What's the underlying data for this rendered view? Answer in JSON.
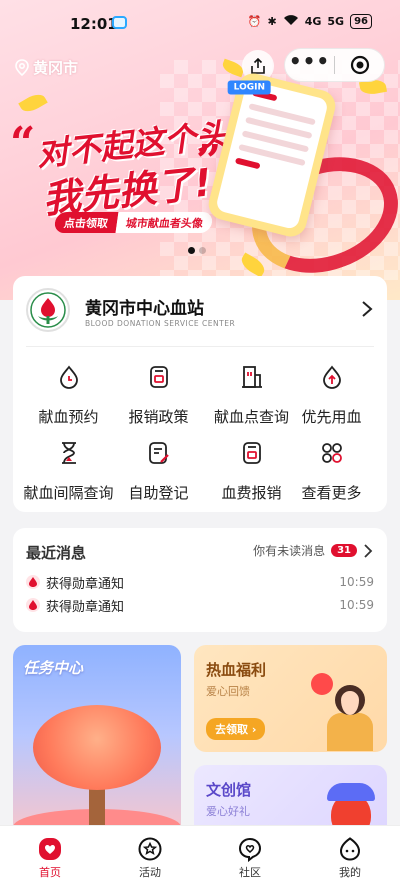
{
  "status_bar": {
    "time": "12:01",
    "battery": "96",
    "signal_labels": [
      "4G",
      "5G"
    ]
  },
  "header": {
    "location": "黄冈市"
  },
  "banner": {
    "headline_line1": "对不起这个头像",
    "headline_line2": "我先换了!",
    "cta_primary": "点击领取",
    "cta_secondary": "城市献血者头像",
    "phone_badge": "LOGIN",
    "page_count": 2,
    "active_page": 1
  },
  "station": {
    "name": "黄冈市中心血站",
    "subtitle": "BLOOD DONATION SERVICE CENTER"
  },
  "services": [
    {
      "label": "献血预约",
      "icon": "clock-drop-icon"
    },
    {
      "label": "报销政策",
      "icon": "policy-icon"
    },
    {
      "label": "献血点查询",
      "icon": "building-icon"
    },
    {
      "label": "优先用血",
      "icon": "priority-drop-icon"
    },
    {
      "label": "献血间隔查询",
      "icon": "hourglass-icon"
    },
    {
      "label": "自助登记",
      "icon": "edit-form-icon"
    },
    {
      "label": "血费报销",
      "icon": "reimburse-icon"
    },
    {
      "label": "查看更多",
      "icon": "grid-more-icon"
    }
  ],
  "news": {
    "title": "最近消息",
    "unread_text": "你有未读消息",
    "unread_count": "31",
    "items": [
      {
        "text": "获得勋章通知",
        "time": "10:59"
      },
      {
        "text": "获得勋章通知",
        "time": "10:59"
      }
    ]
  },
  "tiles": {
    "task": {
      "title": "任务中心"
    },
    "welfare": {
      "title": "热血福利",
      "subtitle": "爱心回馈",
      "button": "去领取 ›"
    },
    "culture": {
      "title": "文创馆",
      "subtitle": "爱心好礼"
    }
  },
  "tabbar": [
    {
      "label": "首页",
      "icon": "home-icon",
      "active": true
    },
    {
      "label": "活动",
      "icon": "star-badge-icon",
      "active": false
    },
    {
      "label": "社区",
      "icon": "heart-chat-icon",
      "active": false
    },
    {
      "label": "我的",
      "icon": "profile-icon",
      "active": false
    }
  ],
  "colors": {
    "brand_red": "#e0102f",
    "welfare_accent": "#f5a623",
    "culture_accent": "#6b5be6"
  }
}
